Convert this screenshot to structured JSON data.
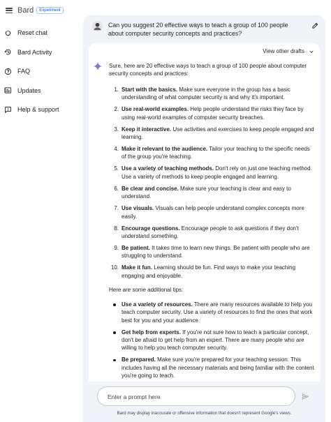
{
  "header": {
    "app_name": "Bard",
    "badge": "Experiment"
  },
  "sidebar": {
    "items": [
      {
        "label": "Reset chat",
        "icon": "reset-icon"
      },
      {
        "label": "Bard Activity",
        "icon": "history-icon"
      },
      {
        "label": "FAQ",
        "icon": "help-icon"
      },
      {
        "label": "Updates",
        "icon": "updates-icon"
      },
      {
        "label": "Help & support",
        "icon": "feedback-icon"
      }
    ]
  },
  "conversation": {
    "user_prompt": "Can you suggest 20 effective ways to teach a group of 100 people about computer security concepts and practices?",
    "view_drafts": "View other drafts",
    "intro": "Sure, here are 20 effective ways to teach a group of 100 people about computer security concepts and practices:",
    "numbered": [
      {
        "num": "1.",
        "bold": "Start with the basics.",
        "text": " Make sure everyone in the group has a basic understanding of what computer security is and why it's important."
      },
      {
        "num": "2.",
        "bold": "Use real-world examples.",
        "text": " Help people understand the risks they face by using real-world examples of computer security breaches."
      },
      {
        "num": "3.",
        "bold": "Keep it interactive.",
        "text": " Use activities and exercises to keep people engaged and learning."
      },
      {
        "num": "4.",
        "bold": "Make it relevant to the audience.",
        "text": " Tailor your teaching to the specific needs of the group you're teaching."
      },
      {
        "num": "5.",
        "bold": "Use a variety of teaching methods.",
        "text": " Don't rely on just one teaching method. Use a variety of methods to keep people engaged and learning."
      },
      {
        "num": "6.",
        "bold": "Be clear and concise.",
        "text": " Make sure your teaching is clear and easy to understand."
      },
      {
        "num": "7.",
        "bold": "Use visuals.",
        "text": " Visuals can help people understand complex concepts more easily."
      },
      {
        "num": "8.",
        "bold": "Encourage questions.",
        "text": " Encourage people to ask questions if they don't understand something."
      },
      {
        "num": "9.",
        "bold": "Be patient.",
        "text": " It takes time to learn new things. Be patient with people who are struggling to understand."
      },
      {
        "num": "10.",
        "bold": "Make it fun.",
        "text": " Learning should be fun. Find ways to make your teaching engaging and enjoyable."
      }
    ],
    "tips_heading": "Here are some additional tips:",
    "tips": [
      {
        "bold": "Use a variety of resources.",
        "text": " There are many resources available to help you teach computer security. Use a variety of resources to find the ones that work best for you and your audience."
      },
      {
        "bold": "Get help from experts.",
        "text": " If you're not sure how to teach a particular concept, don't be afraid to get help from an expert. There are many people who are willing to help you teach computer security."
      },
      {
        "bold": "Be prepared.",
        "text": " Make sure you're prepared for your teaching session. This includes having all the necessary materials and being familiar with the content you're going to teach."
      }
    ]
  },
  "input": {
    "placeholder": "Enter a prompt here"
  },
  "disclaimer": "Bard may display inaccurate or offensive information that doesn't represent Google's views.",
  "colors": {
    "background": "#ffffff",
    "main_panel": "#f0f4f9",
    "accent": "#0b57d0",
    "text": "#1f1f1f"
  }
}
